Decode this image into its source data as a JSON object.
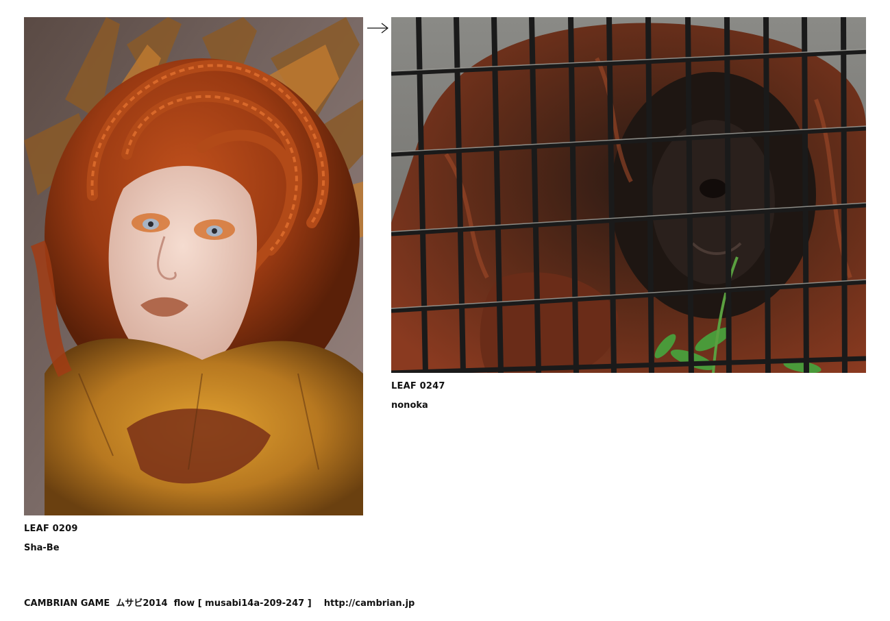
{
  "leaves": [
    {
      "id_label": "LEAF 0209",
      "author": "Sha-Be",
      "image_subject": "woman with red braided hair and feather headdress"
    },
    {
      "id_label": "LEAF 0247",
      "author": "nonoka",
      "image_subject": "orangutan behind cage bars"
    }
  ],
  "arrow_icon": "right-arrow-icon",
  "footer": {
    "title": "CAMBRIAN GAME  ムサビ2014  flow [ musabi14a-209-247 ]",
    "url": "http://cambrian.jp"
  },
  "colors": {
    "background": "#ffffff",
    "text": "#111111"
  }
}
